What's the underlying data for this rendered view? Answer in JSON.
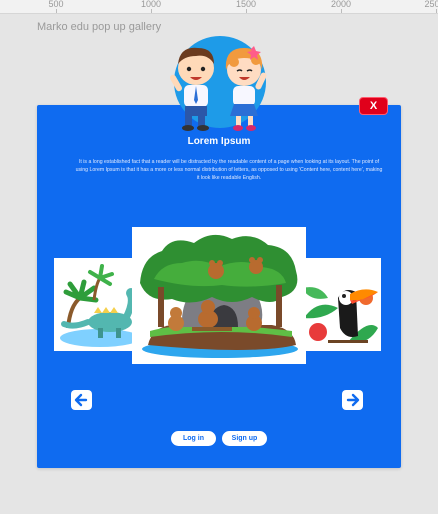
{
  "ruler": {
    "ticks": [
      "500",
      "1000",
      "1500",
      "2000",
      "250"
    ]
  },
  "frame": {
    "title": "Marko edu pop up gallery"
  },
  "modal": {
    "close_label": "X",
    "title": "Lorem Ipsum",
    "body": "It is a long established fact that a reader will be distracted by the readable content of a page when looking at its layout. The point of using Lorem Ipsum is that it has a more or less normal distribution of letters, as opposed to using 'Content here, content here', making it look like readable English.",
    "prev_icon": "arrow-left-icon",
    "next_icon": "arrow-right-icon",
    "login_label": "Log in",
    "signup_label": "Sign up"
  },
  "colors": {
    "modal_bg": "#0f6bf0",
    "close_bg": "#e0001b",
    "page_bg": "#e5e5e5"
  }
}
